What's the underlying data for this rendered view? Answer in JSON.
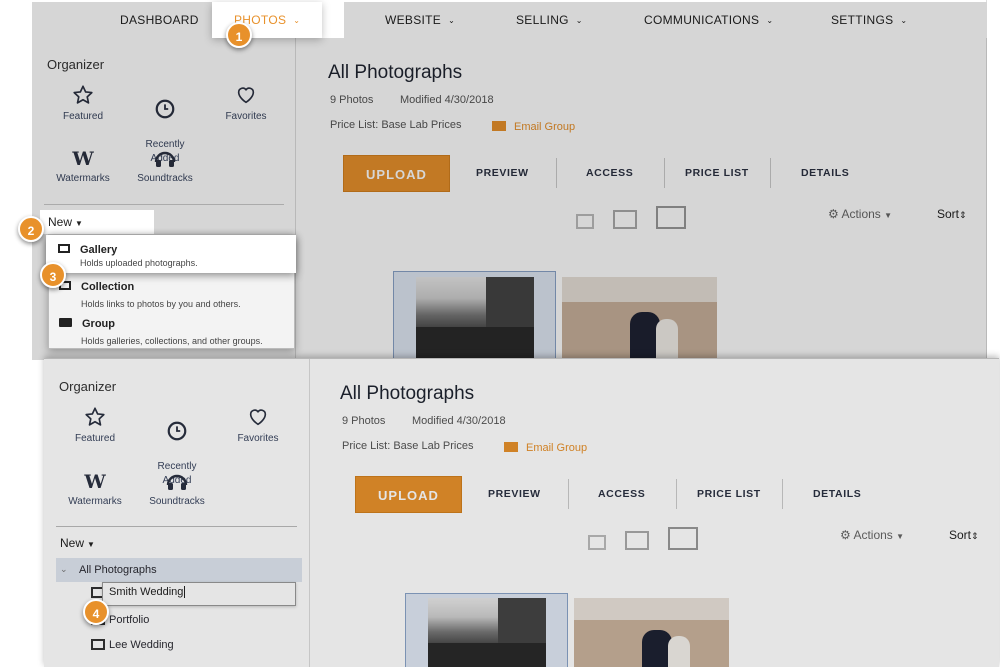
{
  "nav": {
    "dashboard": "DASHBOARD",
    "photos": "PHOTOS",
    "website": "WEBSITE",
    "selling": "SELLING",
    "communications": "COMMUNICATIONS",
    "settings": "SETTINGS"
  },
  "badges": [
    "1",
    "2",
    "3",
    "4"
  ],
  "organizer": {
    "title": "Organizer",
    "items": [
      {
        "label": "Featured",
        "icon": "star-icon"
      },
      {
        "label": "Recently\nAdded",
        "icon": "clock-icon"
      },
      {
        "label": "Favorites",
        "icon": "heart-icon"
      },
      {
        "label": "Watermarks",
        "icon": "watermark-w-icon"
      },
      {
        "label": "Soundtracks",
        "icon": "headphones-icon"
      }
    ],
    "new_label": "New"
  },
  "new_menu": [
    {
      "title": "Gallery",
      "desc": "Holds uploaded photographs."
    },
    {
      "title": "Collection",
      "desc": "Holds links to photos by you and others."
    },
    {
      "title": "Group",
      "desc": "Holds galleries, collections, and other groups."
    }
  ],
  "main": {
    "title": "All Photographs",
    "count": "9 Photos",
    "modified": "Modified 4/30/2018",
    "price_list": "Price List: Base Lab Prices",
    "email_group": "Email Group",
    "upload": "UPLOAD",
    "tabs": [
      "PREVIEW",
      "ACCESS",
      "PRICE LIST",
      "DETAILS"
    ],
    "actions": "Actions",
    "sort": "Sort"
  },
  "tree": {
    "root": "All Photographs",
    "rename_value": "Smith Wedding",
    "items": [
      "Portfolio",
      "Lee Wedding"
    ]
  },
  "colors": {
    "accent": "#e8912b",
    "nav_text": "#222222",
    "selected_row": "#e3e9f2"
  }
}
